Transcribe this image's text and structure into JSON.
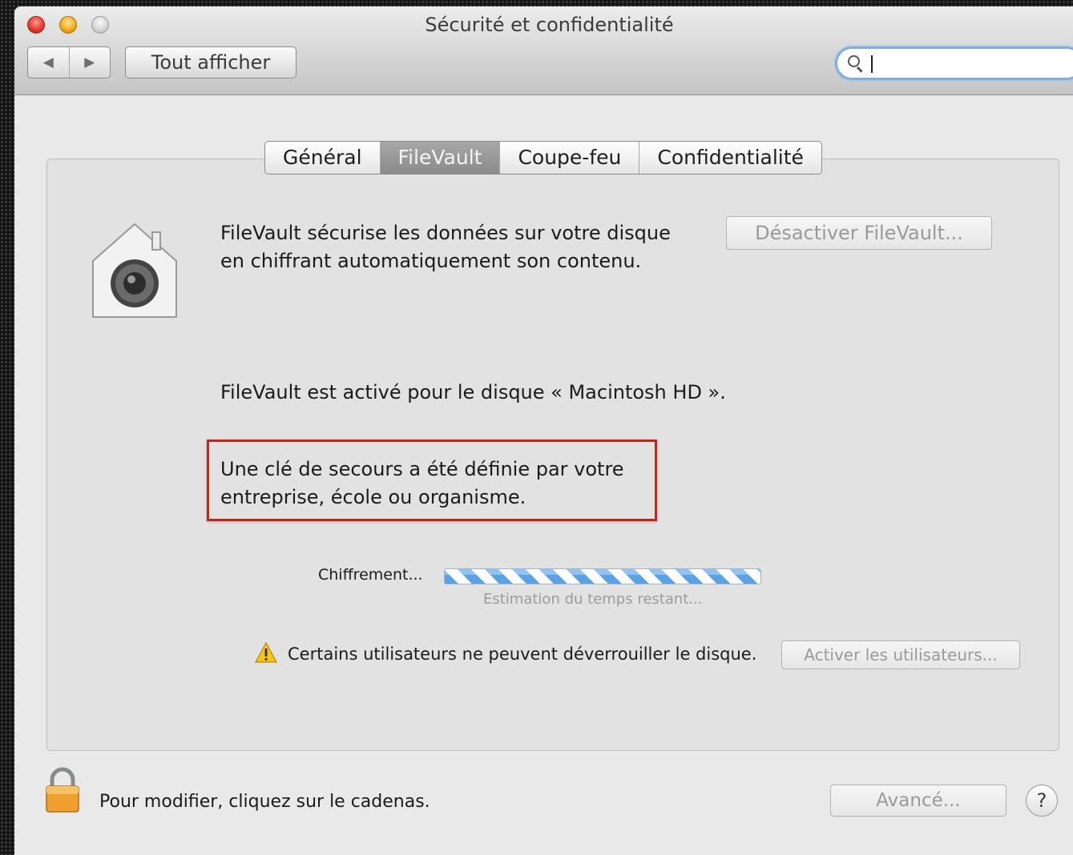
{
  "window": {
    "title": "Sécurité et confidentialité"
  },
  "toolbar": {
    "back_icon": "◀",
    "forward_icon": "▶",
    "show_all_label": "Tout afficher",
    "search_value": ""
  },
  "tabs": [
    {
      "label": "Général",
      "active": false
    },
    {
      "label": "FileVault",
      "active": true
    },
    {
      "label": "Coupe-feu",
      "active": false
    },
    {
      "label": "Confidentialité",
      "active": false
    }
  ],
  "filevault": {
    "description_line1": "FileVault sécurise les données sur votre disque",
    "description_line2": "en chiffrant automatiquement son contenu.",
    "disable_button_label": "Désactiver FileVault...",
    "status_text": "FileVault est activé pour le disque « Macintosh HD ».",
    "recovery_line1": "Une clé de secours a été définie par votre",
    "recovery_line2": "entreprise, école ou organisme.",
    "encryption_label": "Chiffrement...",
    "estimate_text": "Estimation du temps restant...",
    "warning_text": "Certains utilisateurs ne peuvent déverrouiller le disque.",
    "enable_users_label": "Activer les utilisateurs..."
  },
  "footer": {
    "lock_text": "Pour modifier, cliquez sur le cadenas.",
    "advanced_label": "Avancé...",
    "help_label": "?"
  },
  "colors": {
    "highlight_box": "#c0261c",
    "progress_stripe": "#5aa2e4",
    "search_focus": "#7eaee4"
  }
}
